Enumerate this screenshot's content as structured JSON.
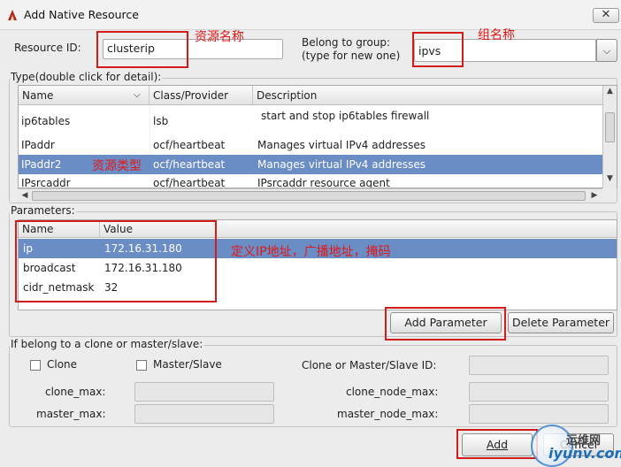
{
  "window": {
    "title": "Add Native Resource",
    "close_glyph": "✕"
  },
  "resource_id": {
    "label": "Resource ID:",
    "value": "clusterip"
  },
  "group": {
    "label_line1": "Belong to group:",
    "label_line2": "(type for new one)",
    "value": "ipvs"
  },
  "type_section": {
    "legend": "Type(double click for detail):",
    "columns": [
      "Name",
      "Class/Provider",
      "Description"
    ],
    "rows": [
      {
        "name": "ip6tables",
        "provider": "lsb",
        "description": "start and stop ip6tables firewall"
      },
      {
        "name": "IPaddr",
        "provider": "ocf/heartbeat",
        "description": "Manages virtual IPv4 addresses"
      },
      {
        "name": "IPaddr2",
        "provider": "ocf/heartbeat",
        "description": "Manages virtual IPv4 addresses"
      },
      {
        "name": "IPsrcaddr",
        "provider": "ocf/heartbeat",
        "description": "IPsrcaddr resource agent"
      }
    ]
  },
  "params_section": {
    "legend": "Parameters:",
    "columns": [
      "Name",
      "Value"
    ],
    "rows": [
      {
        "name": "ip",
        "value": "172.16.31.180"
      },
      {
        "name": "broadcast",
        "value": "172.16.31.180"
      },
      {
        "name": "cidr_netmask",
        "value": "32"
      }
    ],
    "add_button": "Add Parameter",
    "delete_button": "Delete Parameter"
  },
  "clone_section": {
    "legend": "If belong to a clone or master/slave:",
    "clone_label": "Clone",
    "master_slave_label": "Master/Slave",
    "clone_id_label": "Clone or Master/Slave ID:",
    "clone_max_label": "clone_max:",
    "clone_node_max_label": "clone_node_max:",
    "master_max_label": "master_max:",
    "master_node_max_label": "master_node_max:"
  },
  "footer": {
    "add_button": "Add",
    "cancel_button": "Cancel"
  },
  "annotations": {
    "resource_name": "资源名称",
    "group_name": "组名称",
    "resource_type": "资源类型",
    "params_note": "定义IP地址，广播地址，掩码"
  },
  "watermark": {
    "line1": "运维网",
    "line2": "iyunv.com"
  },
  "colors": {
    "selection": "#6b8dc6",
    "annotation_red": "#d21c1c"
  }
}
